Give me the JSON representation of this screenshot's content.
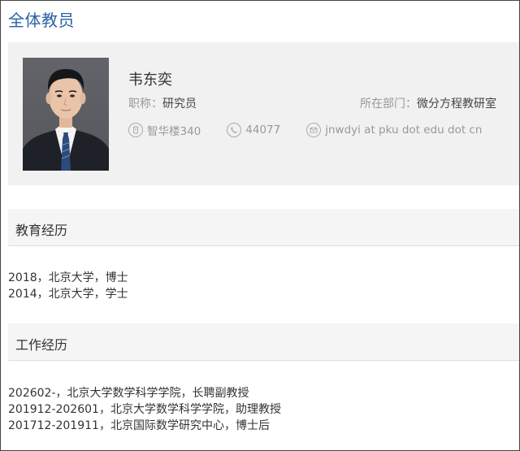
{
  "page": {
    "title": "全体教员"
  },
  "profile": {
    "name": "韦东奕",
    "title_label": "职称：",
    "title_value": "研究员",
    "dept_label": "所在部门：",
    "dept_value": "微分方程教研室",
    "office": "智华楼340",
    "phone": "44077",
    "email": "jnwdyi at pku dot edu dot cn"
  },
  "education": {
    "heading": "教育经历",
    "items": [
      "2018，北京大学，博士",
      "2014，北京大学，学士"
    ]
  },
  "work": {
    "heading": "工作经历",
    "items": [
      "202602-，北京大学数学科学学院，长聘副教授",
      "201912-202601，北京大学数学科学学院，助理教授",
      "201712-201911，北京国际数学研究中心，博士后"
    ]
  },
  "icons": {
    "office": "building-icon",
    "phone": "phone-icon",
    "email": "mail-icon"
  },
  "colors": {
    "title_blue": "#2a62a6",
    "card_bg": "#f1f1f1",
    "muted_text": "#999999"
  }
}
